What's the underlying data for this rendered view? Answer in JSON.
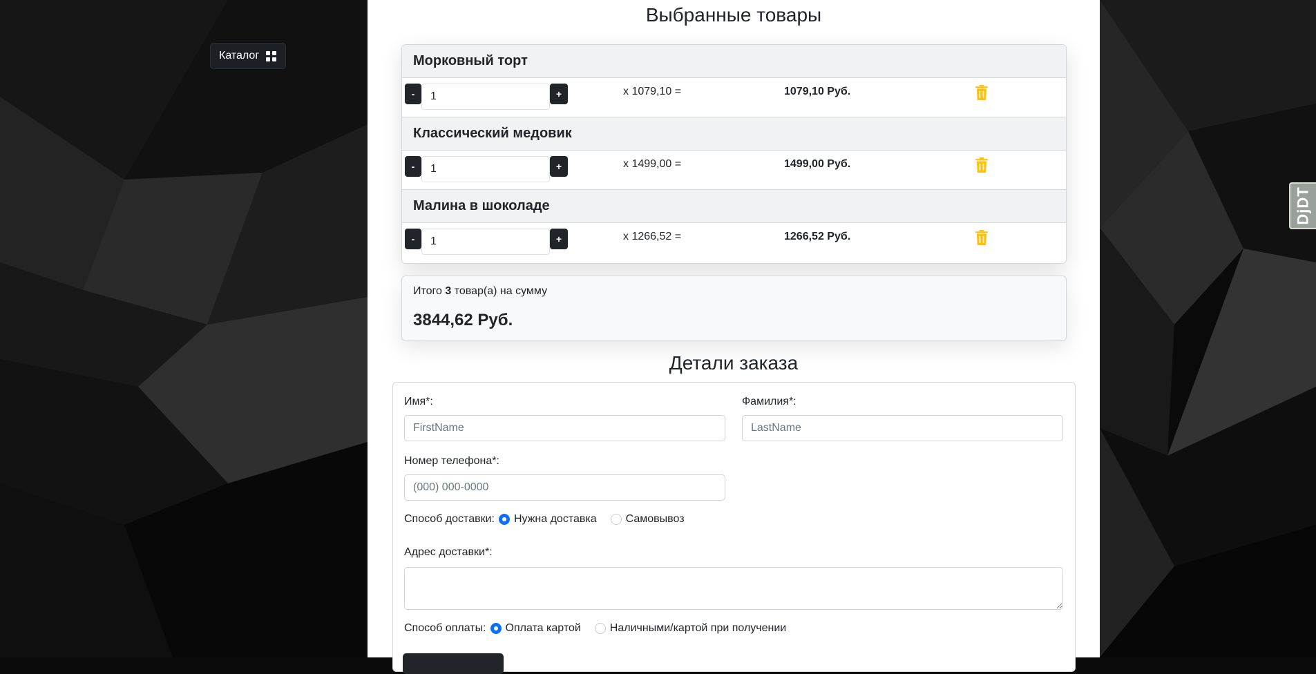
{
  "sidebar": {
    "catalog_label": "Каталог"
  },
  "devtools": {
    "label": "DjDT"
  },
  "cart": {
    "title": "Выбранные товары",
    "items": [
      {
        "name": "Морковный торт",
        "qty": "1",
        "price": "x 1079,10 =",
        "sum": "1079,10 Руб."
      },
      {
        "name": "Классический медовик",
        "qty": "1",
        "price": "x 1499,00 =",
        "sum": "1499,00 Руб."
      },
      {
        "name": "Малина в шоколаде",
        "qty": "1",
        "price": "x 1266,52 =",
        "sum": "1266,52 Руб."
      }
    ],
    "minus_label": "-",
    "plus_label": "+",
    "total_prefix": "Итого",
    "total_count": "3",
    "total_suffix": "товар(а) на сумму",
    "total_sum": "3844,62 Руб."
  },
  "order": {
    "title": "Детали заказа",
    "first_name_label": "Имя*:",
    "first_name_placeholder": "FirstName",
    "last_name_label": "Фамилия*:",
    "last_name_placeholder": "LastName",
    "phone_label": "Номер телефона*:",
    "phone_placeholder": "(000) 000-0000",
    "delivery_label": "Способ доставки:",
    "delivery_options": [
      "Нужна доставка",
      "Самовывоз"
    ],
    "address_label": "Адрес доставки*:",
    "payment_label": "Способ оплаты:",
    "payment_options": [
      "Оплата картой",
      "Наличными/картой при получении"
    ]
  },
  "colors": {
    "accent": "#0d6efd",
    "trash": "#ffc107",
    "dark_button": "#212529"
  }
}
